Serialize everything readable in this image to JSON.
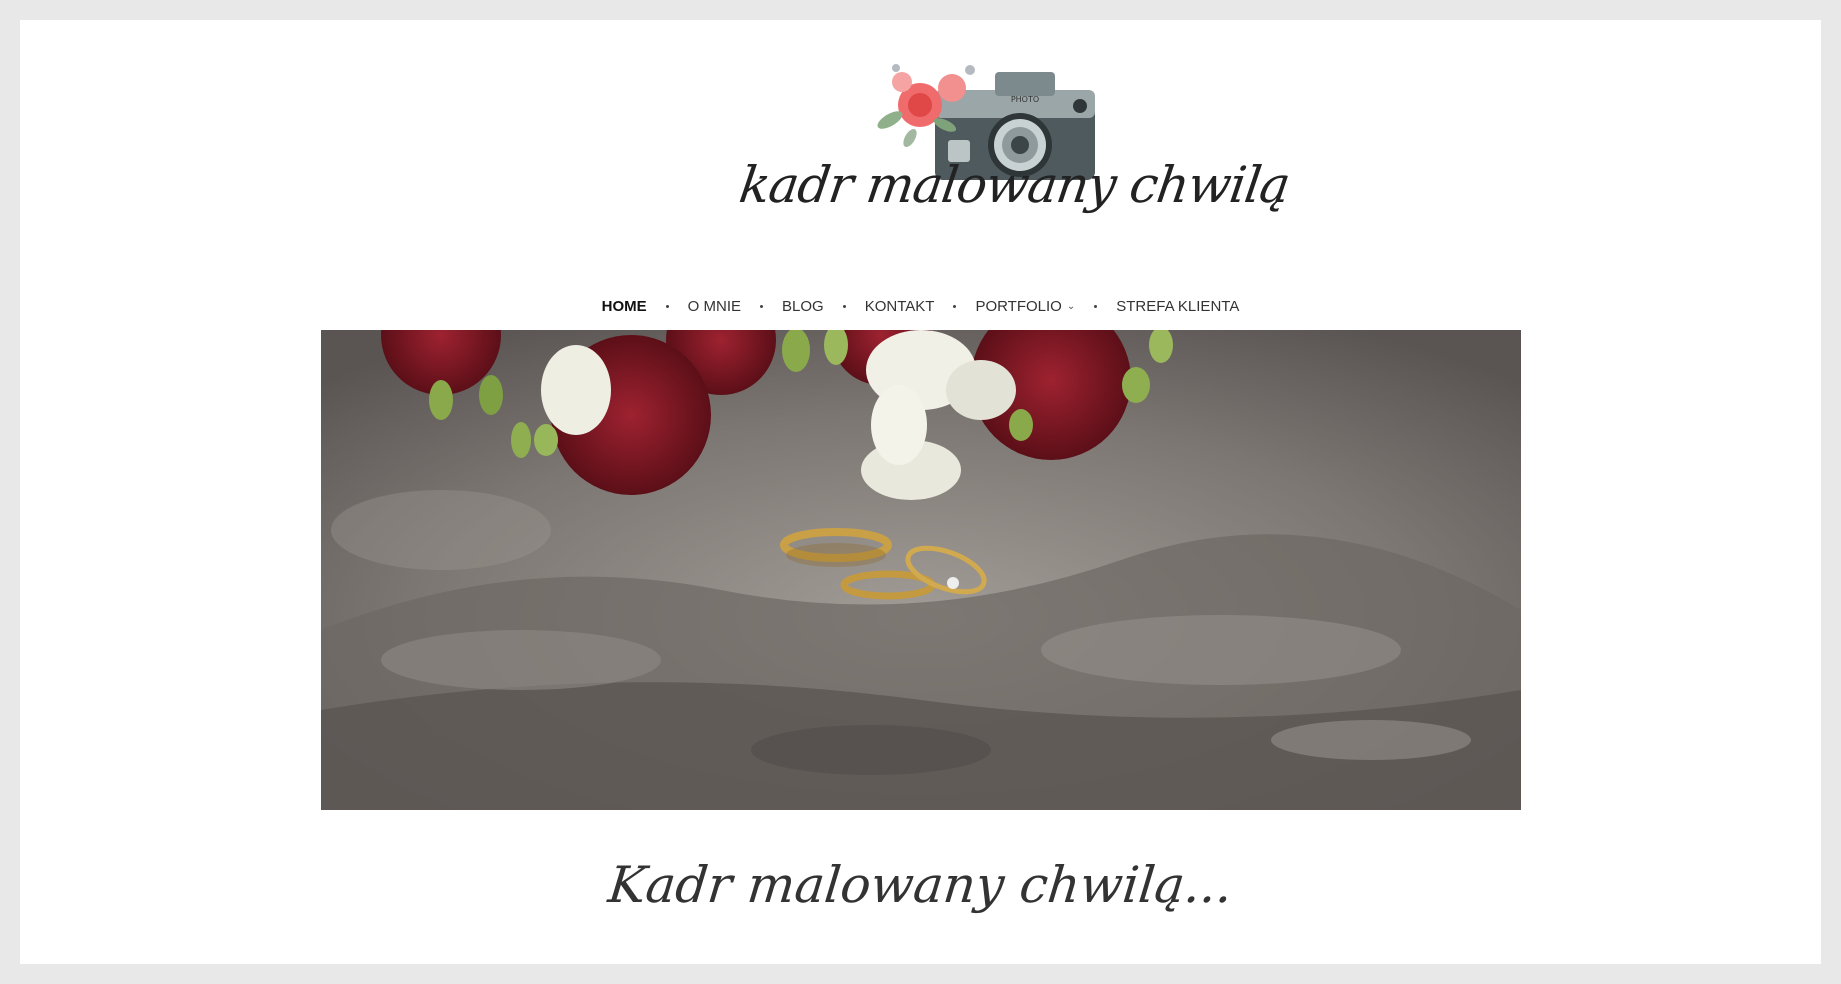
{
  "logo": {
    "text": "kadr malowany chwilą",
    "camera_label": "PHOTO",
    "icon": "camera-with-flowers-icon"
  },
  "nav": {
    "items": [
      {
        "label": "HOME",
        "active": true
      },
      {
        "label": "O MNIE",
        "active": false
      },
      {
        "label": "BLOG",
        "active": false
      },
      {
        "label": "KONTAKT",
        "active": false
      },
      {
        "label": "PORTFOLIO",
        "active": false,
        "has_dropdown": true
      },
      {
        "label": "STREFA KLIENTA",
        "active": false
      }
    ]
  },
  "hero": {
    "description_icon": "wedding-rings-on-rock-with-bouquet-image"
  },
  "tagline": "Kadr malowany chwilą...",
  "colors": {
    "background": "#e8e8e8",
    "page": "#ffffff",
    "text": "#333333",
    "rose": "#7a1622",
    "gold": "#c9a046"
  }
}
